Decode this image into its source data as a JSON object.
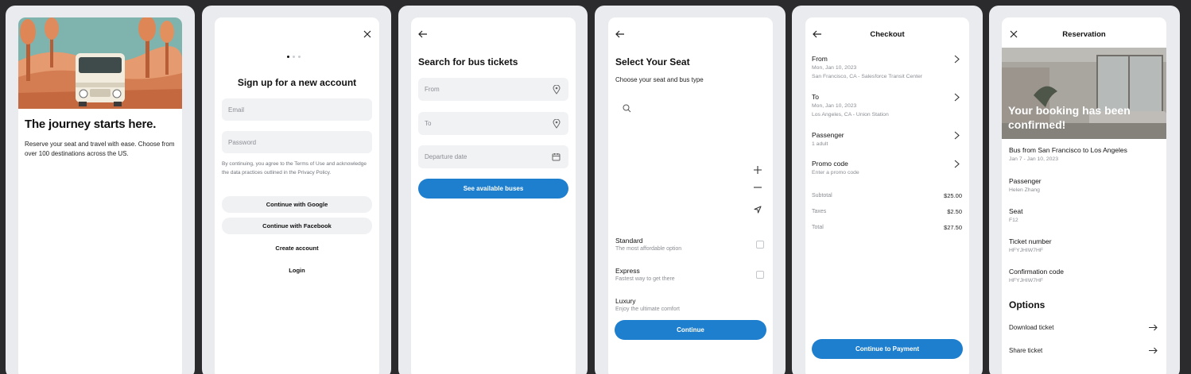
{
  "s1": {
    "title": "The journey starts here.",
    "body": "Reserve your seat and travel with ease. Choose from over 100 destinations across the US."
  },
  "s2": {
    "title": "Sign up for a new account",
    "email_placeholder": "Email",
    "password_placeholder": "Password",
    "legal": "By continuing, you agree to the Terms of Use and acknowledge the data practices outlined in the Privacy Policy.",
    "google": "Continue with Google",
    "facebook": "Continue with Facebook",
    "create": "Create account",
    "login": "Login"
  },
  "s3": {
    "title": "Search for bus tickets",
    "from": "From",
    "to": "To",
    "date": "Departure date",
    "cta": "See available buses"
  },
  "s4": {
    "title": "Select Your Seat",
    "subtitle": "Choose your seat and bus type",
    "options": [
      {
        "name": "Standard",
        "desc": "The most affordable option"
      },
      {
        "name": "Express",
        "desc": "Fastest way to get there"
      },
      {
        "name": "Luxury",
        "desc": "Enjoy the ultimate comfort"
      }
    ],
    "cta": "Continue"
  },
  "s5": {
    "title": "Checkout",
    "rows": [
      {
        "label": "From",
        "sub1": "Mon, Jan 10, 2023",
        "sub2": "San Francisco, CA - Salesforce Transit Center"
      },
      {
        "label": "To",
        "sub1": "Mon, Jan 10, 2023",
        "sub2": "Los Angeles, CA - Union Station"
      },
      {
        "label": "Passenger",
        "sub1": "1 adult"
      },
      {
        "label": "Promo code",
        "sub1": "Enter a promo code"
      }
    ],
    "summary": [
      {
        "label": "Subtotal",
        "value": "$25.00"
      },
      {
        "label": "Taxes",
        "value": "$2.50"
      },
      {
        "label": "Total",
        "value": "$27.50"
      }
    ],
    "cta": "Continue to Payment"
  },
  "s6": {
    "title": "Reservation",
    "banner": "Your booking has been confirmed!",
    "trip": "Bus from San Francisco to Los Angeles",
    "trip_dates": "Jan 7 - Jan 10, 2023",
    "details": [
      {
        "label": "Passenger",
        "value": "Helen Zhang"
      },
      {
        "label": "Seat",
        "value": "F12"
      },
      {
        "label": "Ticket number",
        "value": "HFYJHIW7HF"
      },
      {
        "label": "Confirmation code",
        "value": "HFYJHIW7HF"
      }
    ],
    "options_title": "Options",
    "links": [
      "Download ticket",
      "Share ticket"
    ]
  },
  "colors": {
    "primary": "#1f7fcf",
    "field": "#f1f2f4",
    "canvas": "#2b2b2d",
    "tile": "#e9ebee"
  }
}
